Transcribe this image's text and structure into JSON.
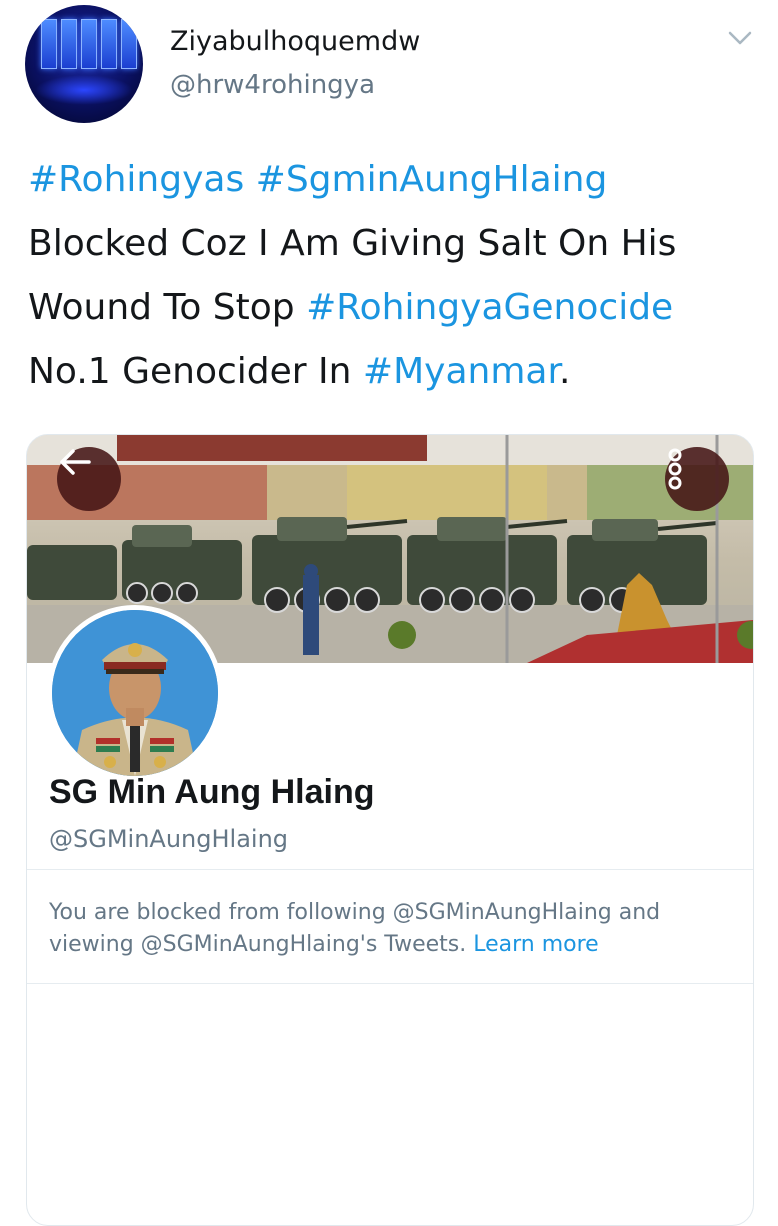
{
  "author": {
    "display_name": "Ziyabulhoquemdw",
    "handle": "@hrw4rohingya"
  },
  "tweet": {
    "line1": [
      {
        "text": "#Rohingyas",
        "hashtag": true
      },
      {
        "text": " ",
        "hashtag": false
      },
      {
        "text": "#SgminAungHlaing",
        "hashtag": true
      }
    ],
    "line2": "Blocked Coz I Am Giving Salt On His",
    "line3_text": "Wound To Stop ",
    "line3_hashtag": "#RohingyaGenocide",
    "line4_text": "No.1 Genocider In ",
    "line4_hashtag": "#Myanmar",
    "line4_end": "."
  },
  "screenshot_card": {
    "profile_name": "SG Min Aung Hlaing",
    "profile_handle": "@SGMinAungHlaing",
    "blocked_line1": "You are blocked from following @SGMinAungHlaing and",
    "blocked_line2": "viewing @SGMinAungHlaing's Tweets. ",
    "learn_more": "Learn more"
  },
  "colors": {
    "hashtag": "#1b95e0",
    "secondary_text": "#657786",
    "primary_text": "#14171a",
    "overlay_button": "#461616"
  },
  "icons": {
    "back": "arrow-left-icon",
    "more": "more-vertical-icon",
    "menu": "chevron-down-icon"
  }
}
